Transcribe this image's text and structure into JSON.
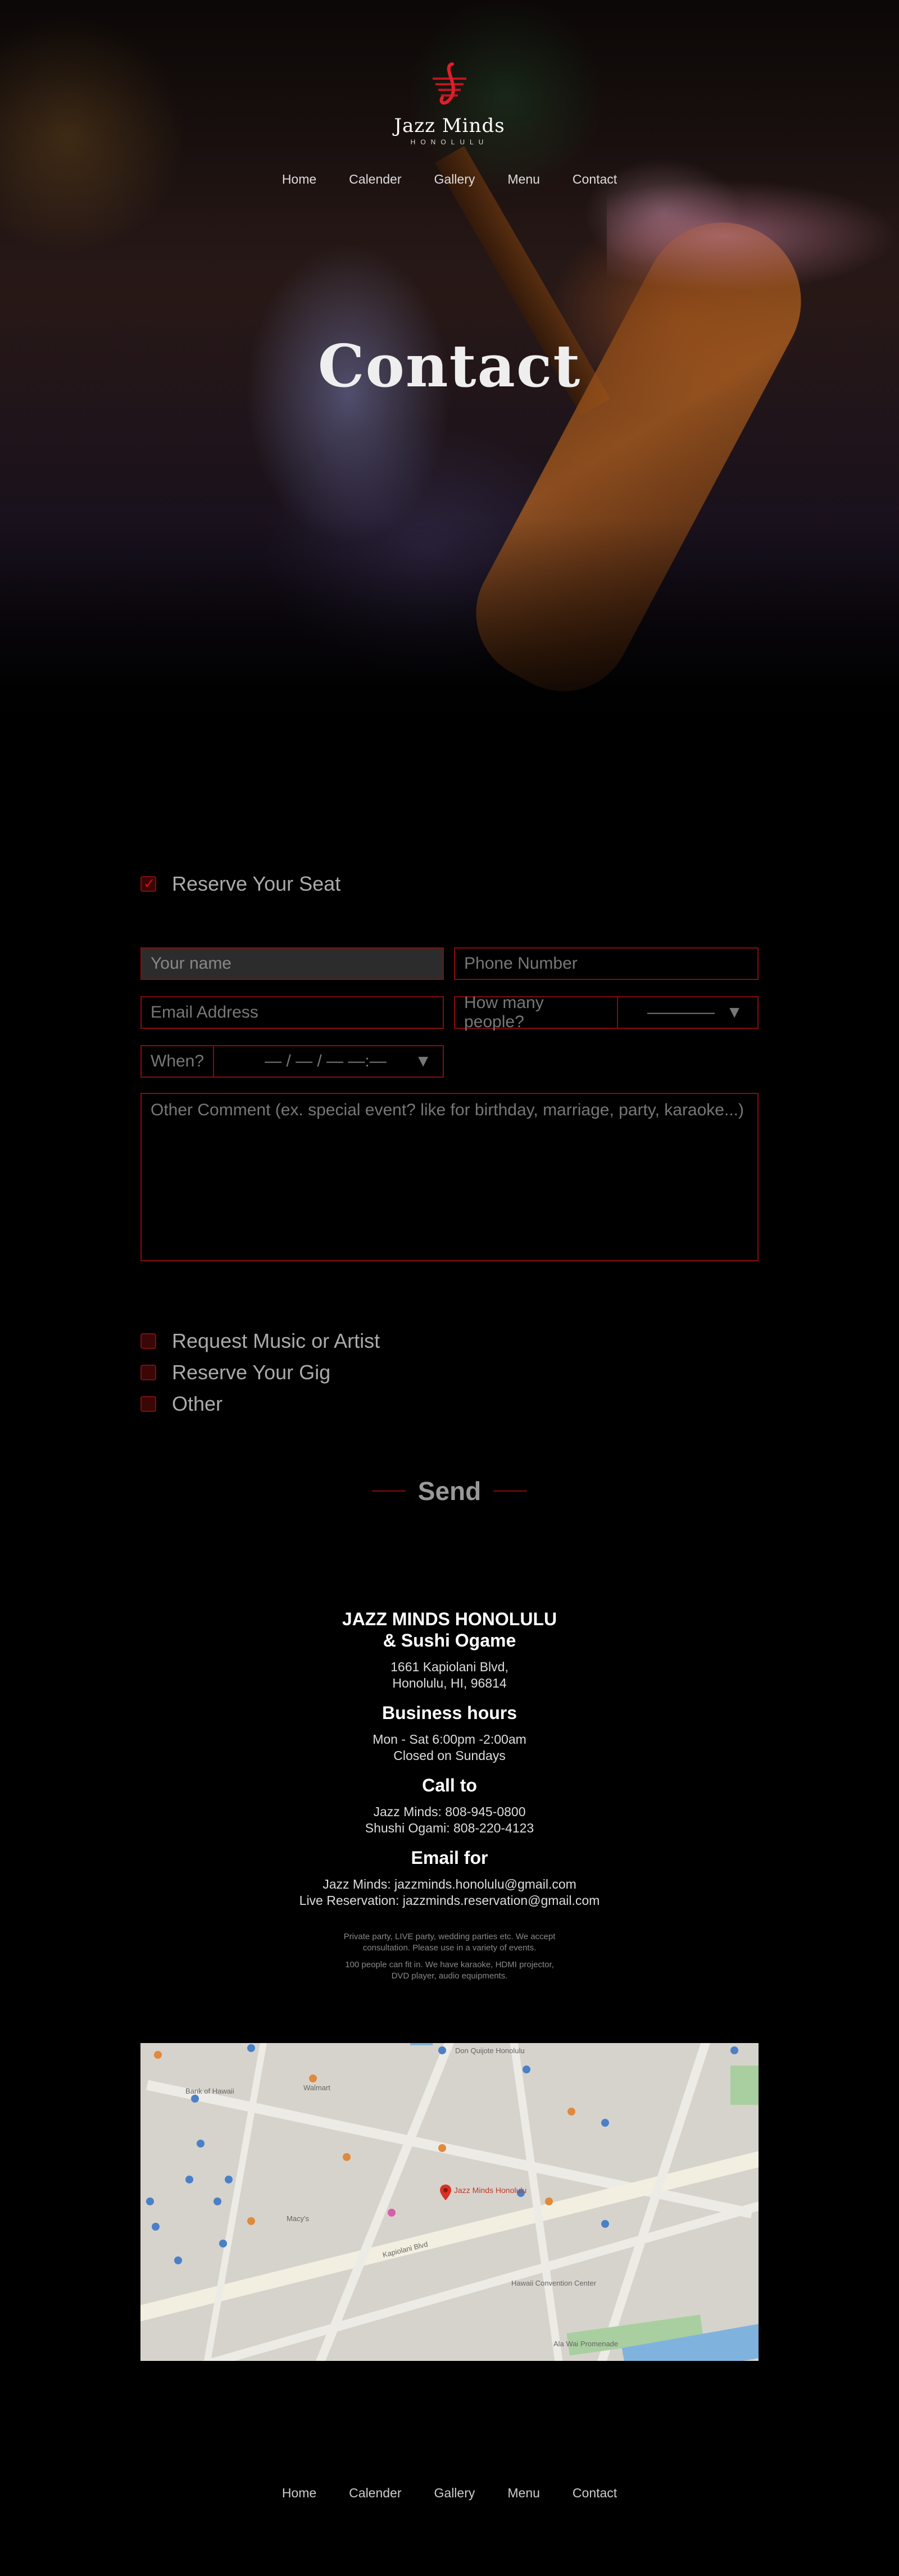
{
  "brand": {
    "name": "Jazz Minds",
    "sub": "HONOLULU"
  },
  "nav": [
    "Home",
    "Calender",
    "Gallery",
    "Menu",
    "Contact"
  ],
  "hero": {
    "title": "Contact"
  },
  "form": {
    "section_title": "Reserve Your Seat",
    "name_placeholder": "Your name",
    "phone_placeholder": "Phone Number",
    "email_placeholder": "Email Address",
    "people_label": "How many people?",
    "people_value": "————",
    "when_label": "When?",
    "when_value": "— / — / —  —:—",
    "comment_placeholder": "Other Comment (ex. special event? like for birthday, marriage, party, karaoke...)",
    "options": [
      "Request Music or Artist",
      "Reserve Your Gig",
      "Other"
    ],
    "send_label": "Send"
  },
  "info": {
    "venue_line1": "JAZZ MINDS HONOLULU",
    "venue_line2": "& Sushi Ogame",
    "address_line1": "1661 Kapiolani Blvd,",
    "address_line2": "Honolulu, HI, 96814",
    "hours_title": "Business hours",
    "hours_line1": "Mon - Sat 6:00pm -2:00am",
    "hours_line2": "Closed on Sundays",
    "call_title": "Call to",
    "call_line1": "Jazz Minds: 808-945-0800",
    "call_line2": "Shushi Ogami: 808-220-4123",
    "email_title": "Email for",
    "email_line1": "Jazz Minds: jazzminds.honolulu@gmail.com",
    "email_line2": "Live Reservation: jazzminds.reservation@gmail.com",
    "note1_line1": "Private party, LIVE party, wedding parties etc. We accept",
    "note1_line2": "consultation. Please use in a variety of events.",
    "note2_line1": "100 people can fit in. We have karaoke, HDMI projector,",
    "note2_line2": "DVD player, audio equipments."
  },
  "map": {
    "pin_label": "Jazz Minds Honolulu",
    "labels": [
      "Bank of Hawaii",
      "Ala Wai Promenade",
      "Hawaii Convention Center",
      "Walmart",
      "Don Quijote Honolulu",
      "Kapiolani Blvd",
      "Macy's"
    ]
  },
  "colors": {
    "accent": "#8a0b0b",
    "bg": "#000000"
  }
}
